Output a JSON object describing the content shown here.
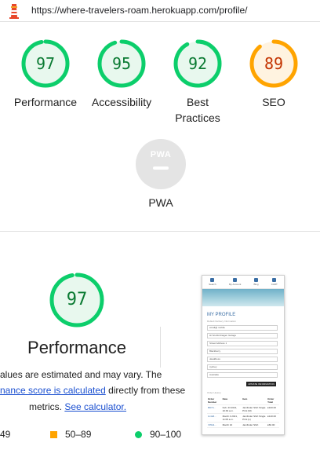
{
  "browser": {
    "url": "https://where-travelers-roam.herokuapp.com/profile/",
    "icon": "lighthouse-icon"
  },
  "colors": {
    "pass": "#0cce6b",
    "pass_text": "#0a7a32",
    "pass_bg": "#e8f8ee",
    "average": "#ffa400",
    "average_text": "#c33300",
    "average_bg": "#fff3e0",
    "na": "#9e9e9e"
  },
  "scores": [
    {
      "id": "performance",
      "label": "Performance",
      "value": "97",
      "fraction": 0.97,
      "status": "pass"
    },
    {
      "id": "accessibility",
      "label": "Accessibility",
      "value": "95",
      "fraction": 0.95,
      "status": "pass"
    },
    {
      "id": "best-practices",
      "label": "Best Practices",
      "value": "92",
      "fraction": 0.92,
      "status": "pass"
    },
    {
      "id": "seo",
      "label": "SEO",
      "value": "89",
      "fraction": 0.89,
      "status": "average"
    }
  ],
  "pwa": {
    "label": "PWA",
    "badge_text": "PWA",
    "status": "not-applicable"
  },
  "performance_detail": {
    "score": "97",
    "fraction": 0.97,
    "title": "Performance",
    "note_line1": "alues are estimated and may vary. The",
    "note_link1": "nance score is calculated",
    "note_line2_rest": " directly from these",
    "note_line3_pre": "metrics. ",
    "note_link2": "See calculator.",
    "legend": [
      {
        "shape": "triangle",
        "text": "49"
      },
      {
        "shape": "square",
        "text": "50–89"
      },
      {
        "shape": "circle",
        "text": "90–100"
      }
    ]
  },
  "thumbnail": {
    "nav_items": [
      "Search",
      "My Account",
      "Blog",
      "CART"
    ],
    "page_title": "MY PROFILE",
    "section_label": "Default Delivery Information",
    "fields": [
      "email@ mobile",
      "Hi Scotfordnagen Garage",
      "Street Address 1",
      "Blackberry",
      "ukaddress",
      "sydney",
      "Australia"
    ],
    "update_button": "UPDATE INFORMATION",
    "order_history_label": "Order History",
    "order_headers": [
      "Order Number",
      "Date",
      "Item",
      "Order Total"
    ],
    "orders": [
      [
        "8bf74...",
        "Feb. 23 2021, 10:49 a.m.",
        "Jamfinder Shirt Single Print (M)",
        "£100.00"
      ],
      [
        "1c4a5...",
        "March 4 2021, 11:05 a.m.",
        "Jamfinder Shirt Single Print (L)",
        "£140.00"
      ],
      [
        "7d5d1...",
        "March 10",
        "Jamfinder Shirt",
        "£60.00"
      ]
    ]
  }
}
